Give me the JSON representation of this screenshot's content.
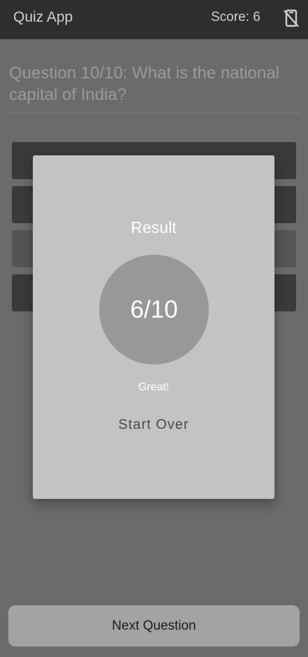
{
  "app_bar": {
    "title": "Quiz App",
    "score_text": "Score: 6",
    "status_icon": "phone-off-icon"
  },
  "question": {
    "text": "Question 10/10: What is the national capital of India?"
  },
  "options": [
    {
      "label": ""
    },
    {
      "label": ""
    },
    {
      "label": ""
    },
    {
      "label": ""
    }
  ],
  "footer": {
    "next_label": "Next Question"
  },
  "dialog": {
    "title": "Result",
    "score": "6/10",
    "feedback": "Great!",
    "start_over_label": "Start Over"
  },
  "colors": {
    "app_bar": "#2e2e2e",
    "background": "#6b6b6b",
    "dialog": "#c3c3c3",
    "circle": "#989898",
    "next_button": "#a3a3a3"
  }
}
